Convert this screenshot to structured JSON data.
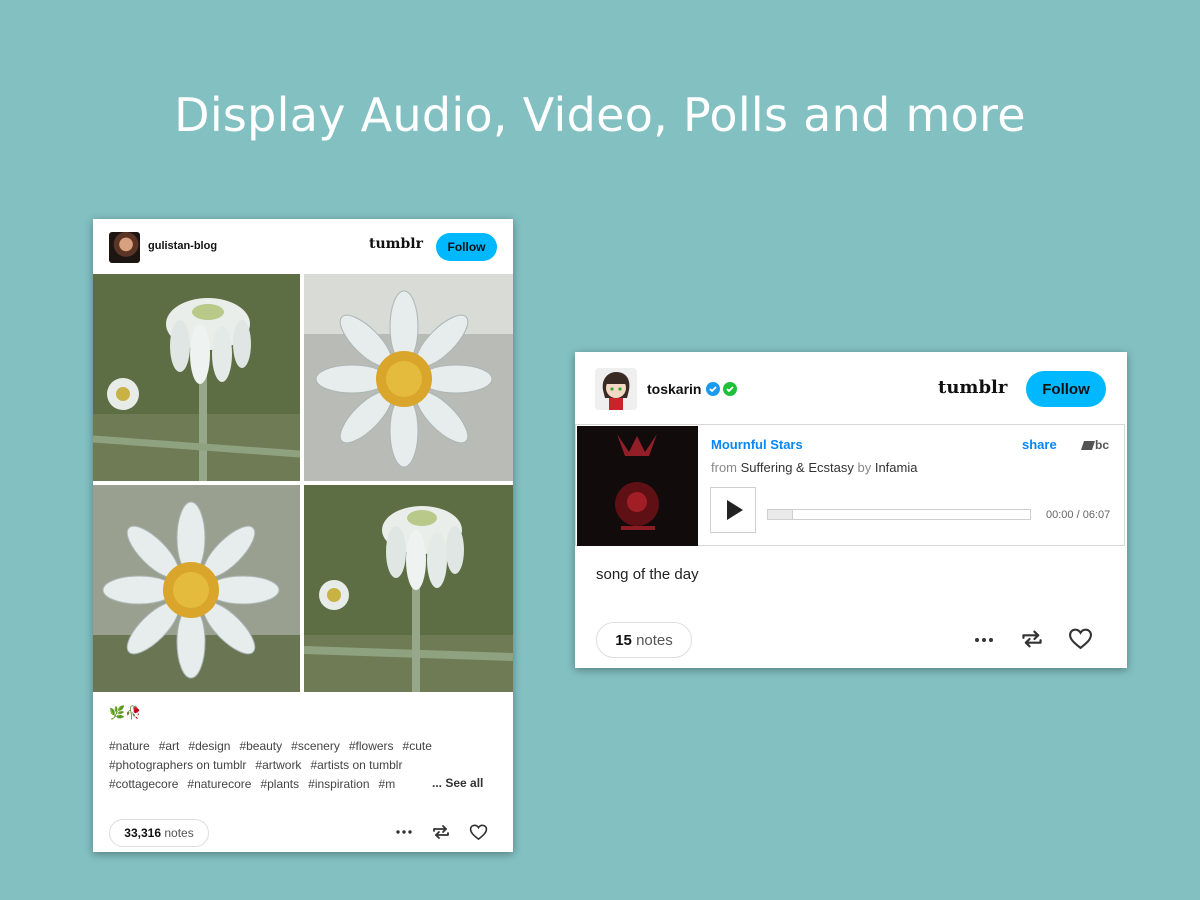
{
  "headline": "Display Audio, Video, Polls and more",
  "colors": {
    "background": "#82c0c2",
    "follow": "#00b8ff",
    "link_blue": "#0687f5"
  },
  "post1": {
    "blog_name": "gulistan-blog",
    "brand": "tumblr",
    "follow_label": "Follow",
    "caption": "🌿🥀",
    "tags_lines": [
      [
        "#nature",
        "#art",
        "#design",
        "#beauty",
        "#scenery",
        "#flowers",
        "#cute"
      ],
      [
        "#photographers on tumblr",
        "#artwork",
        "#artists on tumblr"
      ],
      [
        "#cottagecore",
        "#naturecore",
        "#plants",
        "#inspiration",
        "#m"
      ]
    ],
    "see_all": "... See all",
    "notes_count": "33,316",
    "notes_label": "notes",
    "icons": [
      "more-icon",
      "reblog-icon",
      "heart-icon"
    ]
  },
  "post2": {
    "blog_name": "toskarin",
    "brand": "tumblr",
    "follow_label": "Follow",
    "track": {
      "title": "Mournful Stars",
      "from_label": "from",
      "album": "Suffering & Ecstasy",
      "by_label": "by",
      "artist": "Infamia",
      "share_label": "share",
      "bc_label": "bc",
      "time": "00:00 / 06:07",
      "progress": 0
    },
    "body_text": "song of the day",
    "notes_count": "15",
    "notes_label": "notes",
    "icons": [
      "more-icon",
      "reblog-icon",
      "heart-icon"
    ]
  }
}
